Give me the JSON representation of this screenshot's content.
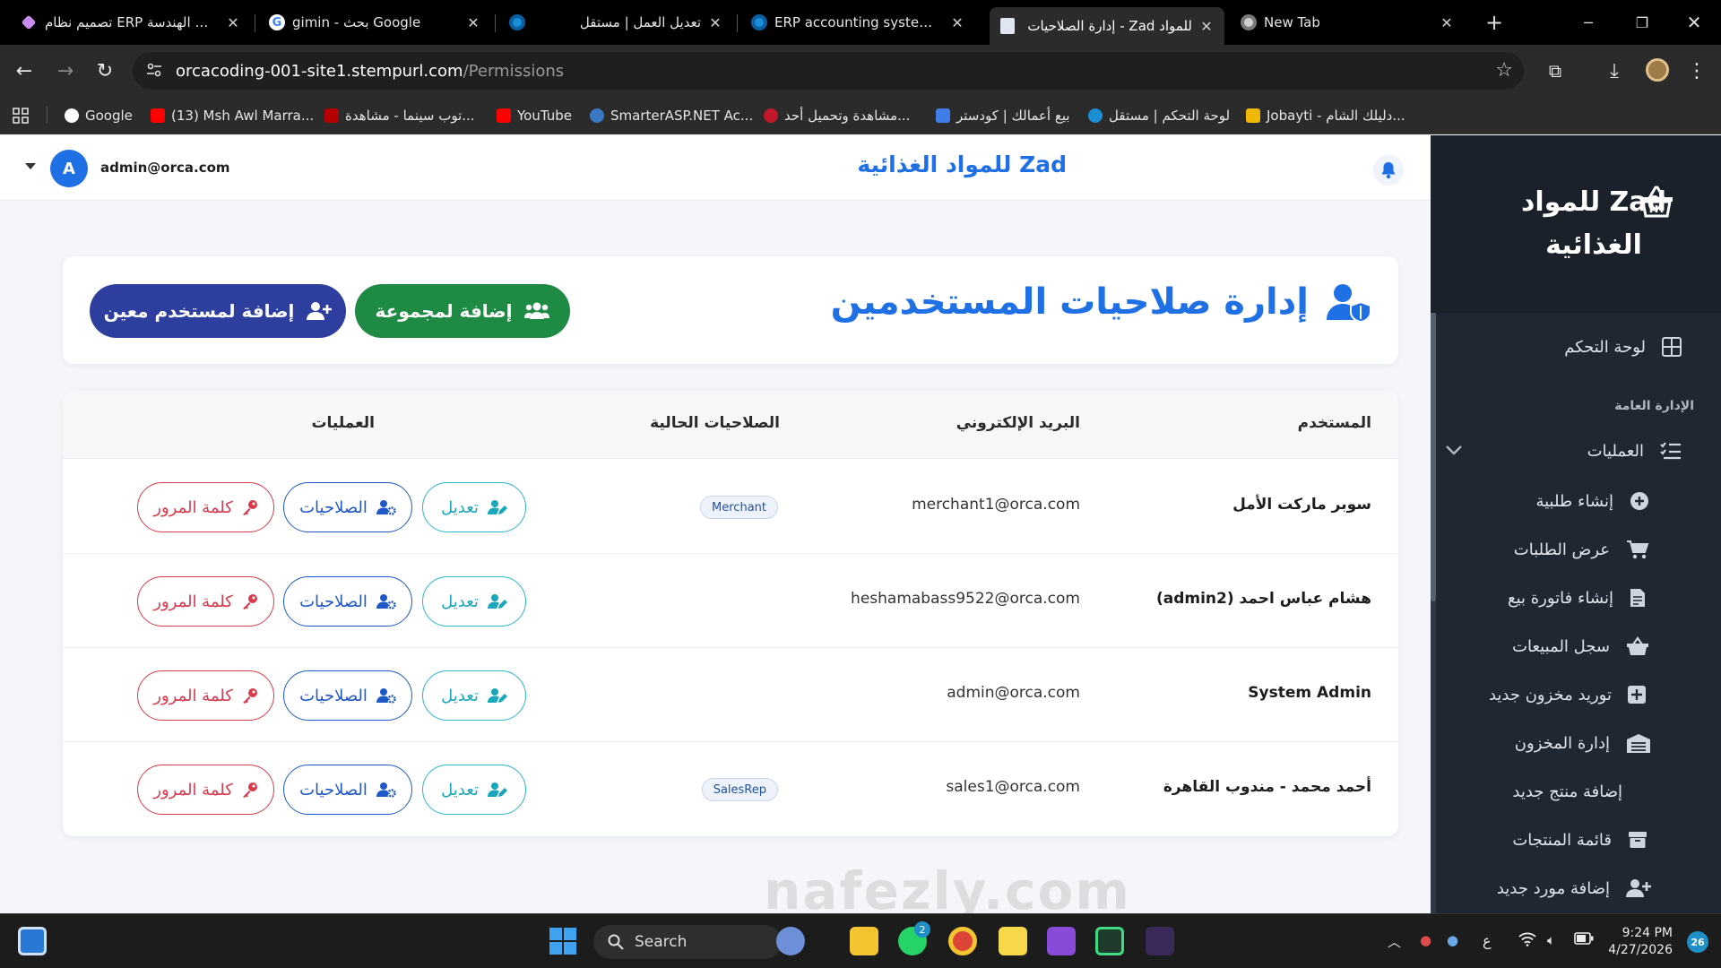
{
  "browser": {
    "tabs": [
      {
        "title": "تصميم نظام ERP لمكاتب الهندسة",
        "fav_color": "#c58cf0"
      },
      {
        "title": "gimin - بحث Google",
        "fav_color": "#ffffff"
      },
      {
        "title": "تعديل العمل | مستقل",
        "fav_color": "#1b8fd6"
      },
      {
        "title": "ERP accounting system for...",
        "fav_color": "#1b8fd6"
      },
      {
        "title": "إدارة الصلاحيات - Zad للمواد",
        "fav_color": "#dfe6f2"
      },
      {
        "title": "New Tab",
        "fav_color": "#cfcfcf"
      }
    ],
    "url_host": "orcacoding-001-site1.stempurl.com",
    "url_path": "/Permissions",
    "bookmarks": [
      {
        "label": "Google",
        "color": "#4285f4"
      },
      {
        "label": "(13) Msh Awl Marra...",
        "color": "#ff0000"
      },
      {
        "label": "توب سينما - مشاهدة...",
        "color": "#b30000"
      },
      {
        "label": "YouTube",
        "color": "#ff0000"
      },
      {
        "label": "SmarterASP.NET Ac...",
        "color": "#3a78c3"
      },
      {
        "label": "مشاهدة وتحميل أحد...",
        "color": "#c2182b"
      },
      {
        "label": "بيع أعمالك | كودستر",
        "color": "#3f7ee8"
      },
      {
        "label": "لوحة التحكم | مستقل",
        "color": "#1b8fd6"
      },
      {
        "label": "Jobayti - دليلك الشام...",
        "color": "#f2b705"
      }
    ]
  },
  "topbar": {
    "user_initial": "A",
    "user_email": "admin@orca.com",
    "brand": "Zad للمواد الغذائية"
  },
  "header": {
    "title": "إدارة صلاحيات المستخدمين",
    "add_group": "إضافة لمجموعة",
    "add_user": "إضافة لمستخدم معين"
  },
  "table": {
    "columns": {
      "user": "المستخدم",
      "email": "البريد الإلكتروني",
      "roles": "الصلاحيات الحالية",
      "actions": "العمليات"
    },
    "rows": [
      {
        "name": "سوبر ماركت الأمل",
        "email": "merchant1@orca.com",
        "role": "Merchant"
      },
      {
        "name": "هشام عباس احمد (admin2)",
        "email": "heshamabass9522@orca.com",
        "role": ""
      },
      {
        "name": "System Admin",
        "email": "admin@orca.com",
        "role": ""
      },
      {
        "name": "أحمد محمد - مندوب القاهرة",
        "email": "sales1@orca.com",
        "role": "SalesRep"
      }
    ],
    "actions": {
      "edit": "تعديل",
      "permissions": "الصلاحيات",
      "password": "كلمة المرور"
    }
  },
  "sidebar": {
    "brand_line1": "Zad للمواد",
    "brand_line2": "الغذائية",
    "dashboard": "لوحة التحكم",
    "section_general": "الإدارة العامة",
    "operations": "العمليات",
    "items": [
      {
        "label": "إنشاء طلبية",
        "icon": "plus-circle-icon"
      },
      {
        "label": "عرض الطلبات",
        "icon": "cart-icon"
      },
      {
        "label": "إنشاء فاتورة بيع",
        "icon": "invoice-icon"
      },
      {
        "label": "سجل المبيعات",
        "icon": "basket-icon"
      },
      {
        "label": "توريد مخزون جديد",
        "icon": "plus-square-icon"
      },
      {
        "label": "إدارة المخزون",
        "icon": "warehouse-icon"
      },
      {
        "label": "إضافة منتج جديد",
        "icon": ""
      },
      {
        "label": "قائمة المنتجات",
        "icon": "box-icon"
      },
      {
        "label": "إضافة مورد جديد",
        "icon": "user-plus-icon"
      }
    ]
  },
  "taskbar": {
    "search": "Search",
    "lang": "ع",
    "time": "9:24 PM",
    "date": "4/27/2026",
    "notifications": "26",
    "whatsapp_badge": "2"
  },
  "watermark": "nafezly.com",
  "colors": {
    "brand_blue": "#1f6fe5",
    "group_green": "#1f8a44",
    "user_indigo": "#2e3e9f",
    "edit_teal": "#1aa6bb",
    "perm_blue": "#1f58c7",
    "pass_red": "#d9394c",
    "sidebar_bg": "#1f2733"
  }
}
